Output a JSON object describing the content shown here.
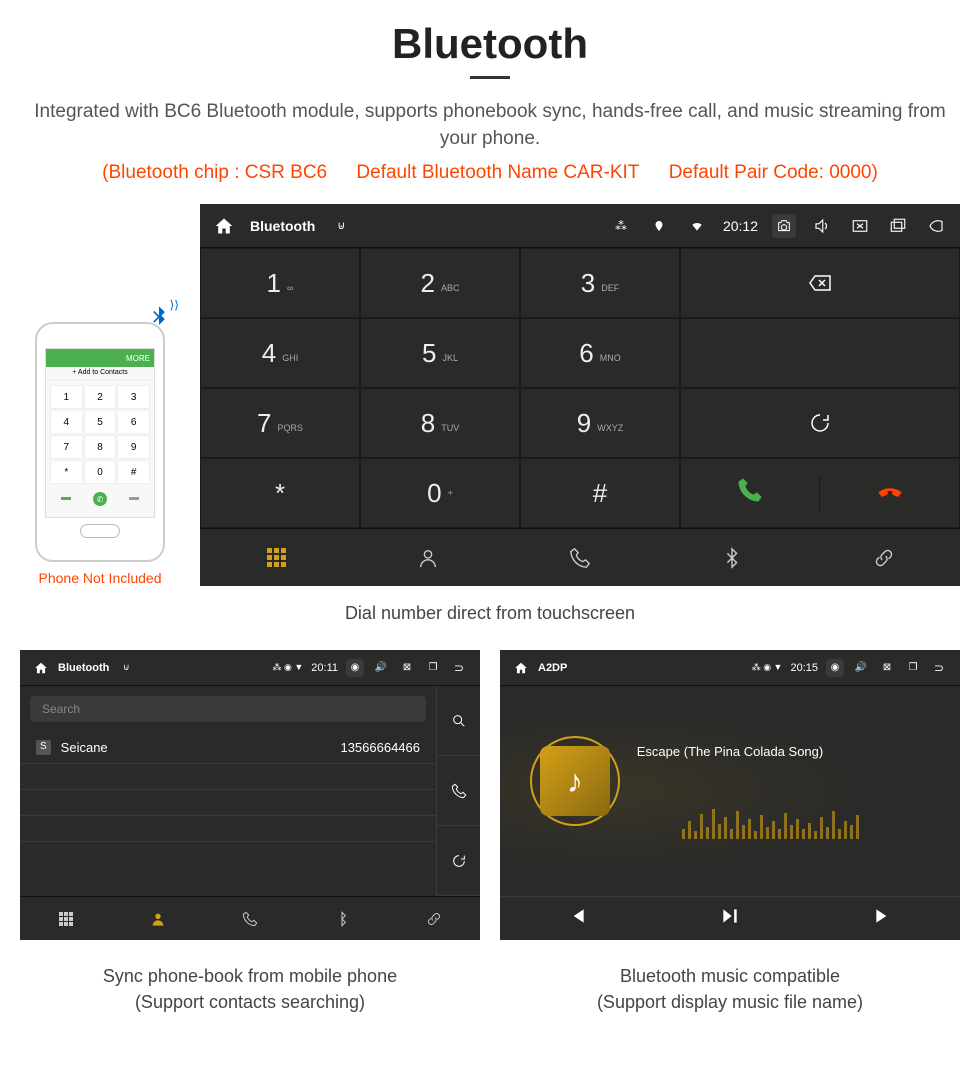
{
  "header": {
    "title": "Bluetooth",
    "subtitle": "Integrated with BC6 Bluetooth module, supports phonebook sync, hands-free call, and music streaming from your phone.",
    "spec_chip": "(Bluetooth chip : CSR BC6",
    "spec_name": "Default Bluetooth Name CAR-KIT",
    "spec_code": "Default Pair Code: 0000)"
  },
  "phone": {
    "caption": "Phone Not Included",
    "topbar": "MORE",
    "addbar": "+  Add to Contacts"
  },
  "dialer": {
    "app_title": "Bluetooth",
    "time": "20:12",
    "keys": [
      {
        "num": "1",
        "sub": "∞"
      },
      {
        "num": "2",
        "sub": "ABC"
      },
      {
        "num": "3",
        "sub": "DEF"
      },
      {
        "num": "4",
        "sub": "GHI"
      },
      {
        "num": "5",
        "sub": "JKL"
      },
      {
        "num": "6",
        "sub": "MNO"
      },
      {
        "num": "7",
        "sub": "PQRS"
      },
      {
        "num": "8",
        "sub": "TUV"
      },
      {
        "num": "9",
        "sub": "WXYZ"
      },
      {
        "num": "*",
        "sub": ""
      },
      {
        "num": "0",
        "sub": "+"
      },
      {
        "num": "#",
        "sub": ""
      }
    ],
    "caption": "Dial number direct from touchscreen"
  },
  "phonebook": {
    "app_title": "Bluetooth",
    "time": "20:11",
    "search_placeholder": "Search",
    "contact_badge": "S",
    "contact_name": "Seicane",
    "contact_number": "13566664466",
    "caption_line1": "Sync phone-book from mobile phone",
    "caption_line2": "(Support contacts searching)"
  },
  "music": {
    "app_title": "A2DP",
    "time": "20:15",
    "song": "Escape (The Pina Colada Song)",
    "caption_line1": "Bluetooth music compatible",
    "caption_line2": "(Support display music file name)"
  }
}
